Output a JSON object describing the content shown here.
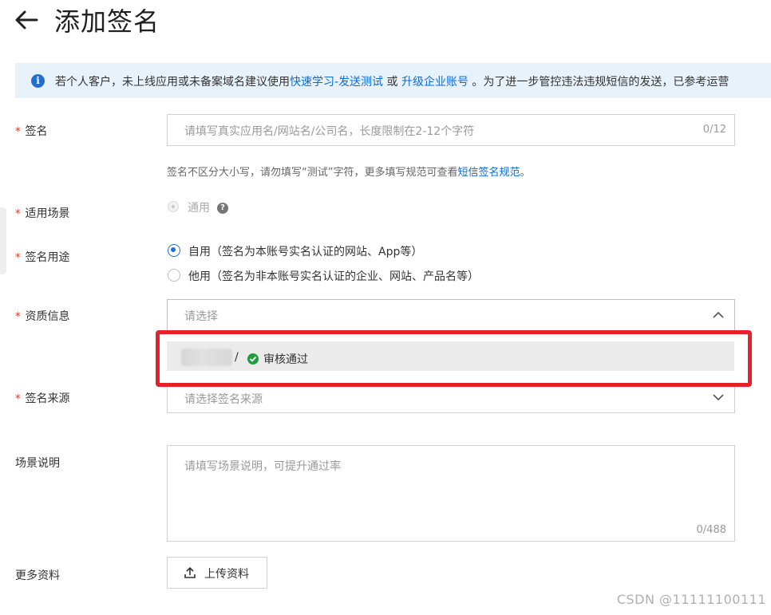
{
  "header": {
    "back_icon": "arrow-left-icon",
    "title": "添加签名"
  },
  "banner": {
    "icon": "info-icon",
    "text_before": "若个人客户，未上线应用或未备案域名建议使用",
    "link1": "快速学习-发送测试",
    "or": " 或 ",
    "link2": "升级企业账号",
    "text_after": " 。为了进一步管控违法违规短信的发送，已参考运营"
  },
  "form": {
    "signature": {
      "label": "签名",
      "placeholder": "请填写真实应用名/网站名/公司名，长度限制在2-12个字符",
      "counter": "0/12",
      "hint_before": "签名不区分大小写，请勿填写“测试”字符，更多填写规范可查看",
      "hint_link": "短信签名规范",
      "hint_after": "。"
    },
    "scene": {
      "label": "适用场景",
      "option": "通用",
      "help_icon": "question-circle-icon"
    },
    "purpose": {
      "label": "签名用途",
      "option_self": "自用（签名为本账号实名认证的网站、App等）",
      "option_other": "他用（签名为非本账号实名认证的企业、网站、产品名等）",
      "selected": "自用"
    },
    "qualification": {
      "label": "资质信息",
      "placeholder": "请选择",
      "chevron_icon": "chevron-up-icon",
      "dropdown_item": {
        "separator": "/",
        "status_icon": "check-circle-icon",
        "status": "审核通过"
      }
    },
    "source": {
      "label": "签名来源",
      "placeholder": "请选择签名来源",
      "chevron_icon": "chevron-down-icon"
    },
    "description": {
      "label": "场景说明",
      "placeholder": "请填写场景说明，可提升通过率",
      "counter": "0/488"
    },
    "more": {
      "label": "更多资料",
      "upload_icon": "upload-icon",
      "upload_label": "上传资料"
    }
  },
  "watermark": "CSDN @11111100111",
  "colors": {
    "accent": "#1f6fd1",
    "link": "#0f6bd0",
    "required": "#e5301c",
    "success": "#1f9d3f",
    "highlight": "#e8202a",
    "banner_bg": "#e8f2fb"
  }
}
